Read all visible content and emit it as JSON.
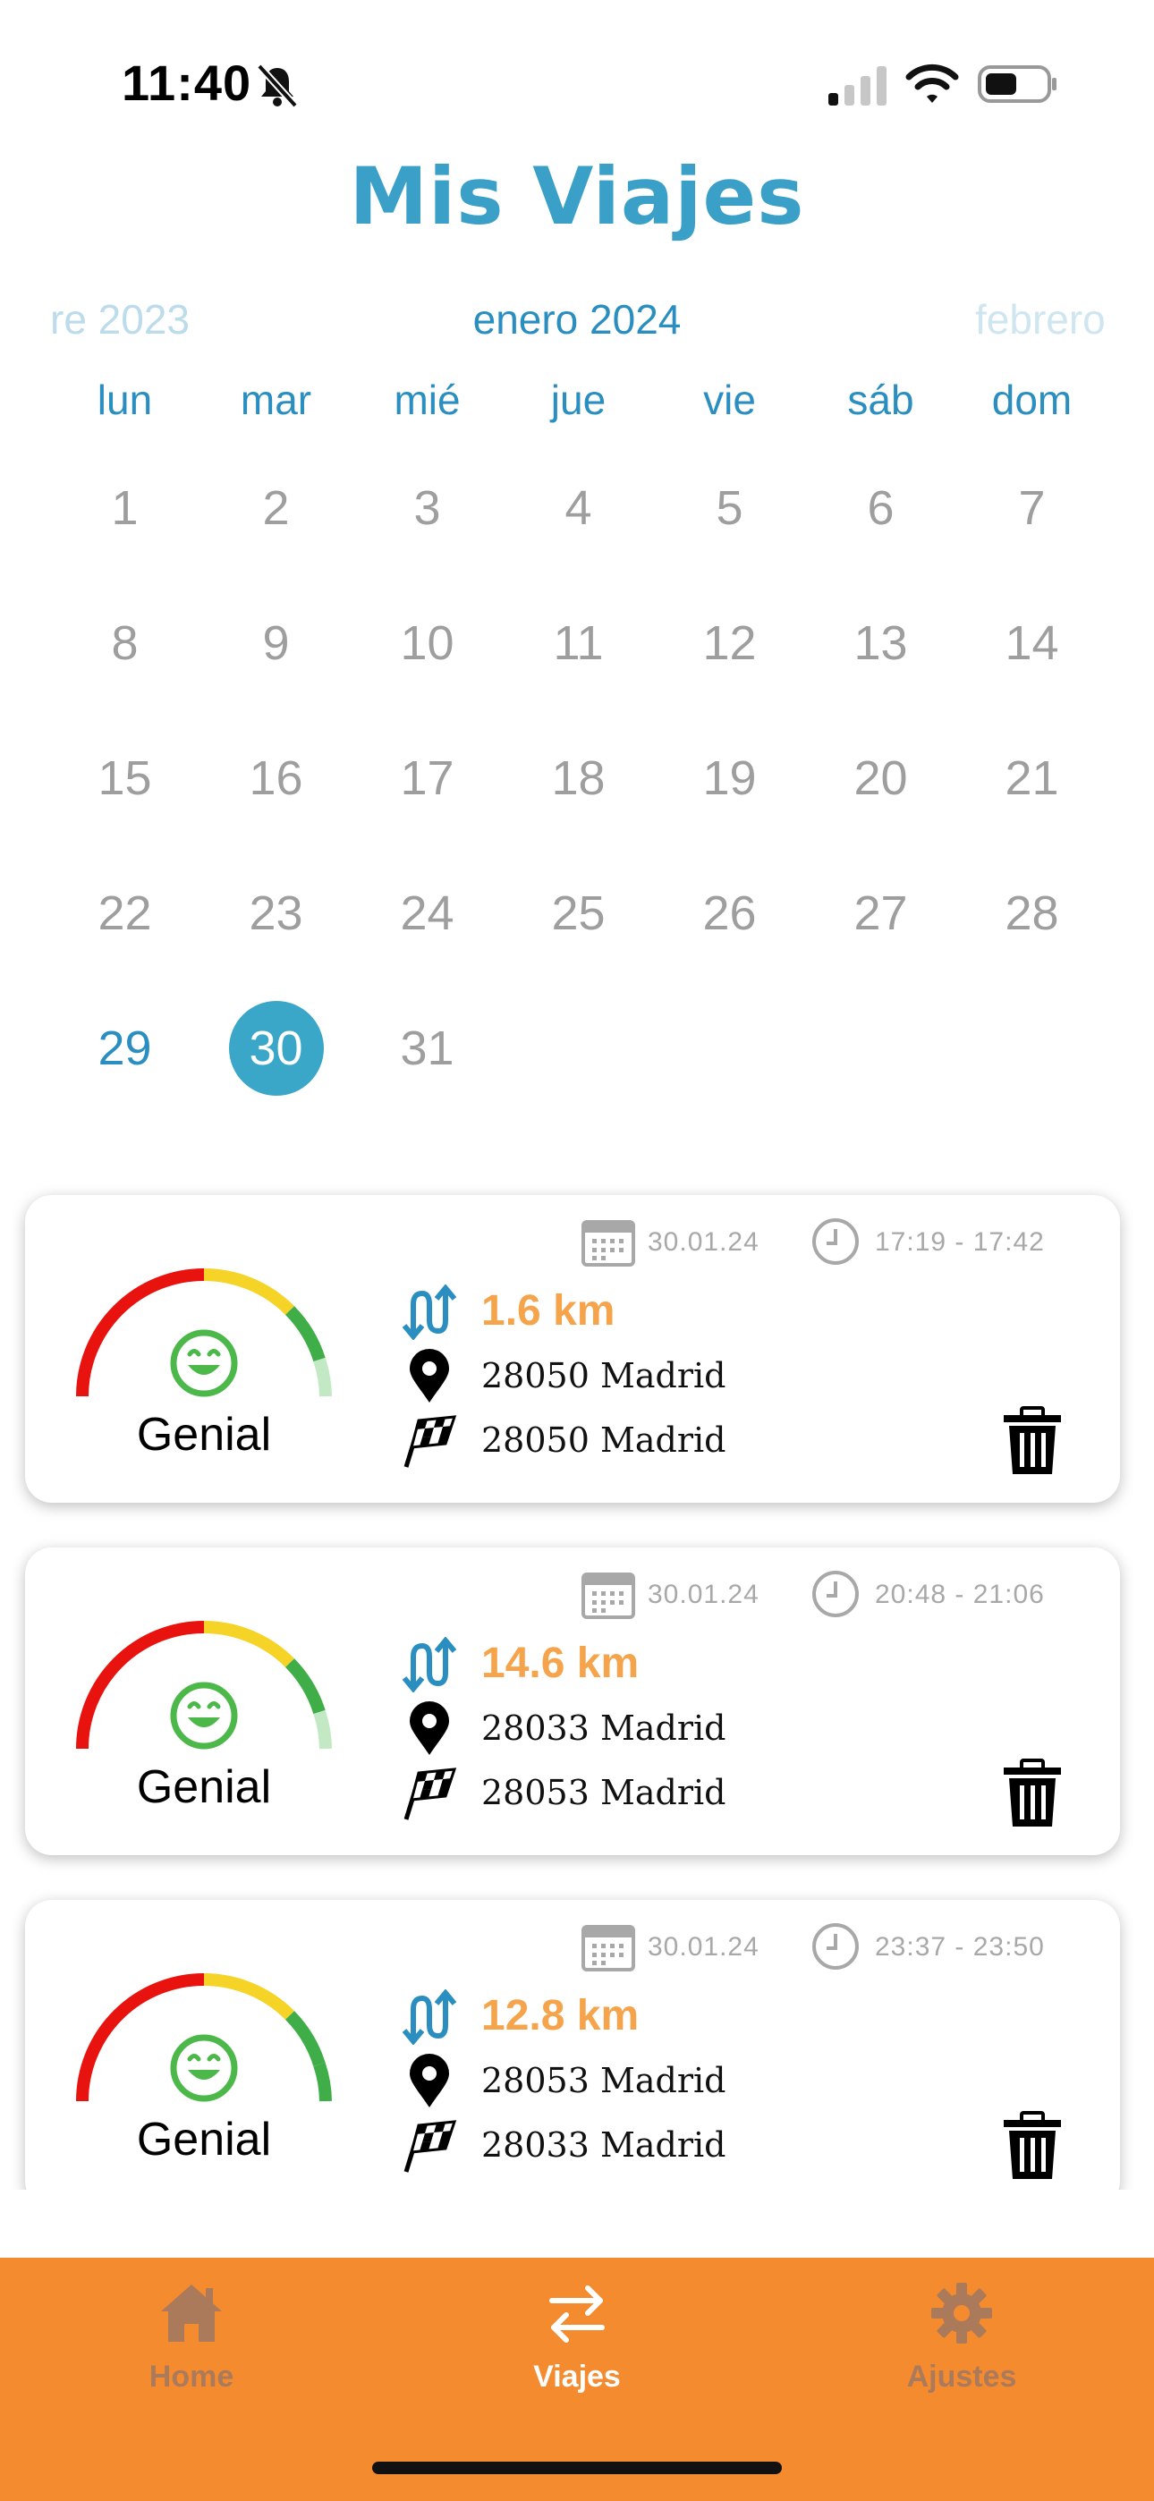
{
  "status_bar": {
    "time": "11:40"
  },
  "header": {
    "title": "Mis Viajes"
  },
  "calendar": {
    "prev_month": "re 2023",
    "current_month": "enero 2024",
    "next_month": "febrero",
    "weekdays": [
      "lun",
      "mar",
      "mié",
      "jue",
      "vie",
      "sáb",
      "dom"
    ],
    "days": [
      "1",
      "2",
      "3",
      "4",
      "5",
      "6",
      "7",
      "8",
      "9",
      "10",
      "11",
      "12",
      "13",
      "14",
      "15",
      "16",
      "17",
      "18",
      "19",
      "20",
      "21",
      "22",
      "23",
      "24",
      "25",
      "26",
      "27",
      "28",
      "29",
      "30",
      "31"
    ],
    "today": "29",
    "selected": "30"
  },
  "trips": [
    {
      "date": "30.01.24",
      "time_range": "17:19 - 17:42",
      "distance": "1.6 km",
      "origin": "28050 Madrid",
      "destination": "28050 Madrid",
      "rating": "Genial"
    },
    {
      "date": "30.01.24",
      "time_range": "20:48 - 21:06",
      "distance": "14.6 km",
      "origin": "28033 Madrid",
      "destination": "28053 Madrid",
      "rating": "Genial"
    },
    {
      "date": "30.01.24",
      "time_range": "23:37 - 23:50",
      "distance": "12.8 km",
      "origin": "28053 Madrid",
      "destination": "28033 Madrid",
      "rating": "Genial"
    }
  ],
  "tabbar": {
    "tabs": [
      {
        "label": "Home",
        "icon": "home-icon",
        "active": false
      },
      {
        "label": "Viajes",
        "icon": "swap-arrows-icon",
        "active": true
      },
      {
        "label": "Ajustes",
        "icon": "gear-icon",
        "active": false
      }
    ]
  },
  "colors": {
    "accent_blue": "#3aa0c8",
    "selected_day": "#3aa7c8",
    "distance_orange": "#f5a44c",
    "tabbar_orange": "#f58b2f",
    "gauge_red": "#e8130f",
    "gauge_yellow": "#f5d327",
    "gauge_green": "#3fae49",
    "smiley_green": "#4cb84a"
  }
}
